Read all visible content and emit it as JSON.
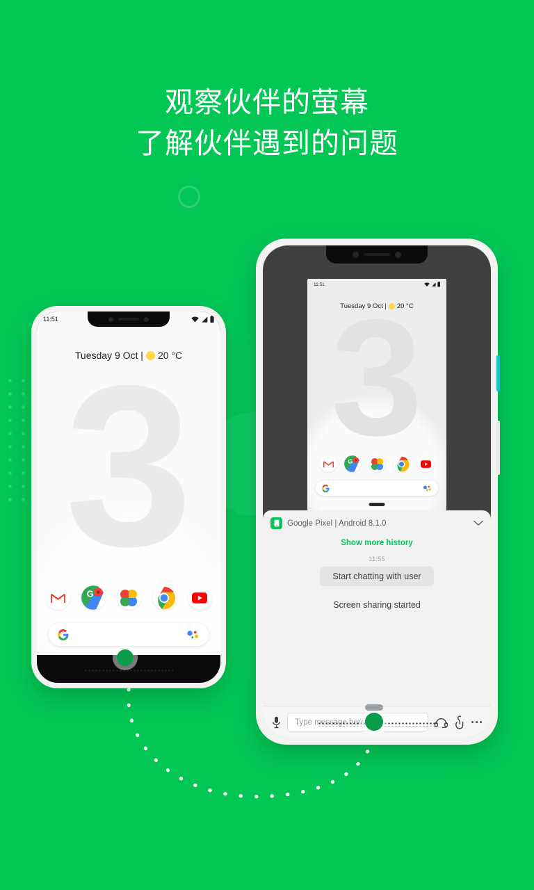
{
  "page": {
    "background_color": "#03c755",
    "accent_color": "#06c755"
  },
  "headline": {
    "line1": "观察伙伴的萤幕",
    "line2": "了解伙伴遇到的问题"
  },
  "left_phone": {
    "name": "customer-phone",
    "status_bar": {
      "time": "11:51",
      "icons": [
        "wifi-icon",
        "signal-icon",
        "battery-icon"
      ]
    },
    "home_screen": {
      "date_weather": "Tuesday 9 Oct |",
      "temperature": "20 °C",
      "wallpaper_text": "3",
      "dock_apps": [
        {
          "name": "gmail",
          "label": "M"
        },
        {
          "name": "google-maps",
          "label": "G"
        },
        {
          "name": "google-photos",
          "label": ""
        },
        {
          "name": "chrome",
          "label": ""
        },
        {
          "name": "youtube",
          "label": ""
        }
      ],
      "search_placeholder": ""
    }
  },
  "right_phone": {
    "name": "agent-phone",
    "mirrored_screen": {
      "status_bar": {
        "time": "11:51",
        "icons": [
          "wifi-icon",
          "signal-icon",
          "battery-icon"
        ]
      },
      "date_weather": "Tuesday 9 Oct |",
      "temperature": "20 °C",
      "wallpaper_text": "3",
      "dock_apps": [
        {
          "name": "gmail",
          "label": "M"
        },
        {
          "name": "google-maps",
          "label": "G"
        },
        {
          "name": "google-photos",
          "label": ""
        },
        {
          "name": "chrome",
          "label": ""
        },
        {
          "name": "youtube",
          "label": ""
        }
      ]
    },
    "chat_panel": {
      "device_title": "Google Pixel | Android 8.1.0",
      "collapse_icon": "chevron-down-icon",
      "show_more_history": "Show more history",
      "message_time": "11:55",
      "bubble_text": "Start chatting with user",
      "system_message": "Screen sharing started"
    },
    "input_bar": {
      "mic_icon": "microphone-icon",
      "input_placeholder": "Type message here",
      "headset_icon": "headset-icon",
      "gesture_icon": "hand-pointer-icon",
      "overflow_icon": "more-options-icon"
    }
  }
}
